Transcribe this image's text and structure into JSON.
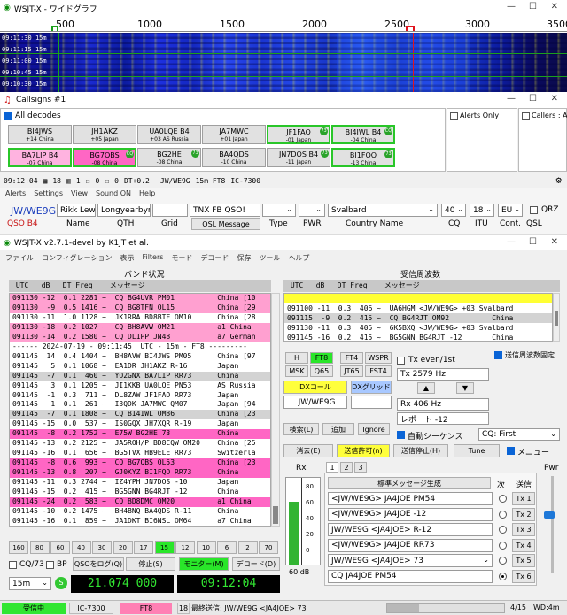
{
  "waterfall": {
    "title": "WSJT-X - ワイドグラフ",
    "scale": [
      "500",
      "1000",
      "1500",
      "2000",
      "2500",
      "3000",
      "3500"
    ],
    "times": [
      "09:11:30",
      "09:11:15",
      "09:11:00",
      "09:10:45",
      "09:10:30"
    ],
    "bands": [
      "15m",
      "15m",
      "15m",
      "15m",
      "15m"
    ]
  },
  "callsigns": {
    "title": "Callsigns #1",
    "all_decodes": "All decodes",
    "alerts_only": "Alerts Only",
    "callers_label": "Callers : Aler",
    "cards": [
      {
        "call": "BI4JWS",
        "sub": "+14 China",
        "badge": "",
        "bg": "#e1e1e1",
        "border": "#9f9f9f"
      },
      {
        "call": "JH1AKZ",
        "sub": "+05 Japan",
        "badge": "",
        "bg": "#e1e1e1",
        "border": "#9f9f9f"
      },
      {
        "call": "UA0LQE B4",
        "sub": "+03 AS Russia",
        "badge": "",
        "bg": "#e1e1e1",
        "border": "#9f9f9f"
      },
      {
        "call": "JA7MWC",
        "sub": "+01 Japan",
        "badge": "",
        "bg": "#e1e1e1",
        "border": "#9f9f9f"
      },
      {
        "call": "JF1FAO",
        "sub": "-01 Japan",
        "badge": "73",
        "bg": "#e1e1e1",
        "border": "#29c629"
      },
      {
        "call": "BI4IWL B4",
        "sub": "-04 China",
        "badge": "CQ",
        "bg": "#e1e1e1",
        "border": "#29c629"
      },
      {
        "call": "BA7LIP B4",
        "sub": "-07 China",
        "badge": "",
        "bg": "#ffb3e0",
        "border": "#29c629"
      },
      {
        "call": "BG7QBS",
        "sub": "-08 China",
        "badge": "CQ",
        "bg": "#ff66c4",
        "border": "#29c629"
      },
      {
        "call": "BG2HE",
        "sub": "-08 China",
        "badge": "73",
        "bg": "#e1e1e1",
        "border": "#9f9f9f"
      },
      {
        "call": "BA4QDS",
        "sub": "-10 China",
        "badge": "",
        "bg": "#e1e1e1",
        "border": "#9f9f9f"
      },
      {
        "call": "JN7DOS B4",
        "sub": "-11 Japan",
        "badge": "73",
        "bg": "#e1e1e1",
        "border": "#9f9f9f"
      },
      {
        "call": "BI1FQO",
        "sub": "-13 China",
        "badge": "73",
        "bg": "#e1e1e1",
        "border": "#29c629"
      }
    ],
    "status": {
      "time": "09:12:04",
      "n1": "18",
      "n2": "1",
      "n3": "0",
      "n4": "0",
      "dt": "DT+0.2",
      "call": "JW/WE9G",
      "band": "15m FT8",
      "rig": "IC-7300"
    }
  },
  "logbar": {
    "menu": [
      "Alerts",
      "Settings",
      "View",
      "Sound ON",
      "Help"
    ],
    "call": "JW/WE9G",
    "qso": "QSO B4",
    "name": "Rikk Lewis",
    "qth": "Longyearbyrn",
    "grid": "",
    "message": "TNX FB QSO!",
    "country": "Svalbard",
    "cq": "40",
    "itu": "18",
    "cont": "EU",
    "labels": {
      "name": "Name",
      "qth": "QTH",
      "grid": "Grid",
      "qsl_msg": "QSL Message",
      "type": "Type",
      "pwr": "PWR",
      "country": "Country Name",
      "cq": "CQ",
      "itu": "ITU",
      "cont": "Cont.",
      "qsl": "QSL",
      "qrz": "QRZ"
    }
  },
  "main": {
    "title": "WSJT-X   v2.7.1-devel   by K1JT et al.",
    "menu": [
      "ファイル",
      "コンフィグレーション",
      "表示",
      "Filters",
      "モード",
      "デコード",
      "保存",
      "ツール",
      "ヘルプ"
    ],
    "left_title": "バンド状況",
    "right_title": "受信周波数",
    "header": " UTC   dB   DT Freq    メッセージ",
    "left_rows": [
      {
        "t": "091130 -12  0.1 2281 ~  CQ BG4UVR PM01          China [10",
        "bg": "#ffa0d0"
      },
      {
        "t": "091130  -9  0.5 1416 ~  CQ BG8TFN OL15          China [29",
        "bg": "#ffa0d0"
      },
      {
        "t": "091130 -11  1.0 1128 ~  JK1RRA BD8BTF OM10      China [28",
        "bg": "#ffffff"
      },
      {
        "t": "091130 -18  0.2 1027 ~  CQ BH8AVW OM21          a1 China",
        "bg": "#ffa0d0"
      },
      {
        "t": "091130 -14  0.2 1580 ~  CQ DL1PP JN48           a7 German",
        "bg": "#ffa0d0"
      },
      {
        "t": "------ 2024-07-19 - 09:11:45  UTC - 15m - FT8 ---------",
        "bg": "#ffffff"
      },
      {
        "t": "091145  14  0.4 1404 ~  BH8AVW BI4JWS PM05      China [97",
        "bg": "#ffffff"
      },
      {
        "t": "091145   5  0.1 1068 ~  EA1DR JH1AKZ R-16       Japan",
        "bg": "#ffffff"
      },
      {
        "t": "091145  -7  0.1  460 ~  YO2GNX BA7LIP RR73      China",
        "bg": "#d3d3d3"
      },
      {
        "t": "091145   3  0.1 1205 ~  JI1KKB UA0LQE PN53      AS Russia",
        "bg": "#ffffff"
      },
      {
        "t": "091145  -1  0.3  711 ~  DL8ZAW JF1FAO RR73      Japan",
        "bg": "#ffffff"
      },
      {
        "t": "091145   1  0.1  261 ~  I3QDK JA7MWC QM07       Japan [94",
        "bg": "#ffffff"
      },
      {
        "t": "091145  -7  0.1 1808 ~  CQ BI4IWL OM86          China [23",
        "bg": "#d3d3d3"
      },
      {
        "t": "091145 -15  0.0  537 ~  IS0GQX JH7XQR R-19      Japan",
        "bg": "#ffffff"
      },
      {
        "t": "091145  -8  0.2 1752 ~  E75W BG2HE 73           China",
        "bg": "#ff66c4"
      },
      {
        "t": "091145 -13  0.2 2125 ~  JA5ROH/P BD8CQW OM20    China [25",
        "bg": "#ffffff"
      },
      {
        "t": "091145 -16  0.1  656 ~  BG5TVX HB9ELE RR73      Switzerla",
        "bg": "#ffffff"
      },
      {
        "t": "091145  -8  0.6  993 ~  CQ BG7QBS OL53          China [23",
        "bg": "#ff66c4"
      },
      {
        "t": "091145 -13  0.8  207 ~  GJ0KYZ BI1FQO RR73      China",
        "bg": "#ff66c4"
      },
      {
        "t": "091145 -11  0.3 2744 ~  IZ4YPH JN7DOS -10       Japan",
        "bg": "#ffffff"
      },
      {
        "t": "091145 -15  0.2  415 ~  BG5GNN BG4RJT -12       China",
        "bg": "#ffffff"
      },
      {
        "t": "091145 -24  0.2  583 ~  CQ BD8DMC OM20          a1 China",
        "bg": "#ff66c4"
      },
      {
        "t": "091145 -10  0.2 1475 ~  BH4BNQ BA4QDS R-11      China",
        "bg": "#ffffff"
      },
      {
        "t": "091145 -16  0.1  859 ~  JA1DKT BI6NSL OM64      a7 China",
        "bg": "#ffffff"
      }
    ],
    "right_rows": [
      {
        "t": "",
        "bg": "#ffff33"
      },
      {
        "t": "091100 -11  0.3  406 ~  UA6HGM <JW/WE9G> +03 Svalbard",
        "bg": "#ffffff"
      },
      {
        "t": "091115  -9  0.2  415 ~  CQ BG4RJT OM92          China",
        "bg": "#d3d3d3"
      },
      {
        "t": "091130 -11  0.3  405 ~  6K5BXQ <JW/WE9G> +03 Svalbard",
        "bg": "#ffffff"
      },
      {
        "t": "091145 -16  0.2  415 ~  BG5GNN BG4RJT -12       China",
        "bg": "#ffffff"
      }
    ],
    "modes": [
      "H",
      "FT8",
      "FT4",
      "WSPR",
      "MSK",
      "Q65",
      "JT65",
      "FST4"
    ],
    "tx_even": "Tx even/1st",
    "tx_freq": "Tx  2579  Hz",
    "rx_freq": "Rx  406  Hz",
    "report": "レポート -12",
    "hold_tx": "送信周波数固定",
    "dx_call_btn": "DXコール",
    "dx_grid_btn": "DXグリッド",
    "dx_call": "JW/WE9G",
    "dx_grid": "",
    "search": "検索(L)",
    "add": "追加",
    "ignore": "Ignore",
    "auto_seq": "自動シーケンス",
    "cq_first": "CQ: First",
    "menu_chk": "メニュー",
    "erase": "消去(E)",
    "enable_tx": "送信許可(n)",
    "halt_tx": "送信停止(H)",
    "tune": "Tune",
    "rx_label": "Rx",
    "pwr_label": "Pwr",
    "db_label": "60 dB",
    "meter_ticks": [
      "80",
      "60",
      "40",
      "20",
      "0"
    ],
    "meter_fraction": 0.72,
    "tabs": [
      "1",
      "2",
      "3"
    ],
    "std_msg": "標準メッセージ生成",
    "next": "次",
    "send": "送信",
    "tx_msgs": [
      {
        "msg": "<JW/WE9G> JA4JOE PM54",
        "btn": "Tx 1"
      },
      {
        "msg": "<JW/WE9G> JA4JOE -12",
        "btn": "Tx 2"
      },
      {
        "msg": "JW/WE9G <JA4JOE> R-12",
        "btn": "Tx 3"
      },
      {
        "msg": "<JW/WE9G> JA4JOE RR73",
        "btn": "Tx 4"
      },
      {
        "msg": "JW/WE9G <JA4JOE> 73",
        "btn": "Tx 5"
      },
      {
        "msg": "CQ JA4JOE PM54",
        "btn": "Tx 6"
      }
    ],
    "bands": [
      "160",
      "80",
      "60",
      "40",
      "30",
      "20",
      "17",
      "15",
      "12",
      "10",
      "6",
      "2",
      "70"
    ],
    "cq73": "CQ/73",
    "bp": "BP",
    "log_qso": "QSOをログ(Q)",
    "stop": "停止(S)",
    "monitor": "モニター(M)",
    "decode": "デコード(D)",
    "band_sel": "15m",
    "freq": "21.074 000",
    "clock": "09:12:04",
    "status": {
      "rx": "受信中",
      "rig": "IC-7300",
      "mode": "FT8",
      "counter": "18",
      "last_tx": "最終送信: JW/WE9G <JA4JOE> 73",
      "page": "4/15",
      "wd": "WD:4m"
    }
  }
}
